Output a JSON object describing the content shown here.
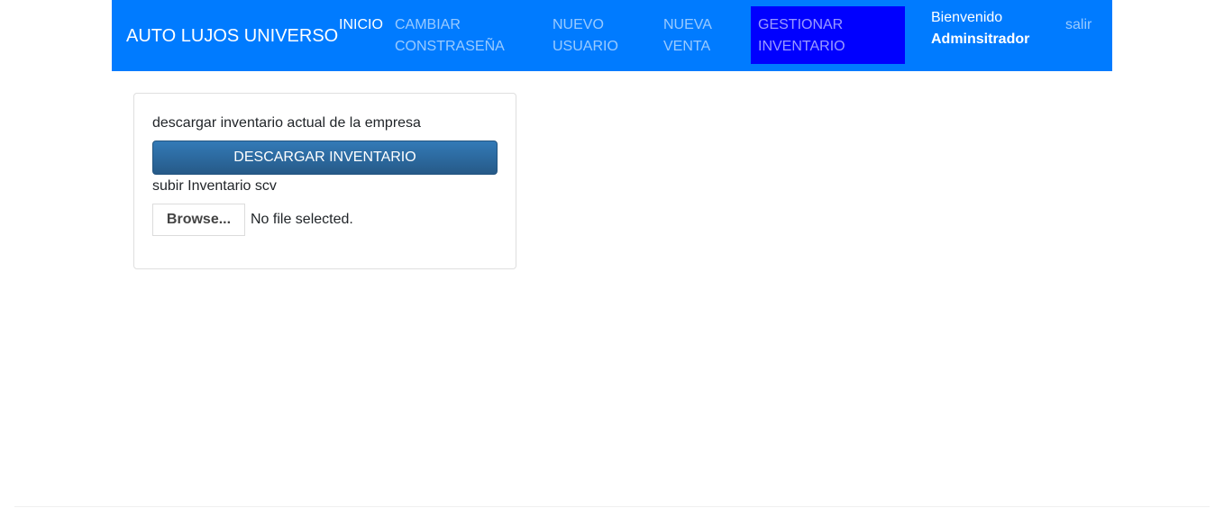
{
  "navbar": {
    "brand": "AUTO LUJOS UNIVERSO",
    "links": {
      "inicio": "INICIO",
      "cambiar": "CAMBIAR CONSTRASEÑA",
      "nuevo_usuario": "NUEVO USUARIO",
      "nueva_venta": "NUEVA VENTA",
      "gestionar": "GESTIONAR INVENTARIO"
    },
    "welcome": {
      "greeting": "Bienvenido",
      "user": "Adminsitrador"
    },
    "logout": "salir",
    "colors": {
      "background": "#007bff",
      "active_highlight": "#0000ff"
    }
  },
  "inventory_card": {
    "download_label": "descargar inventario actual de la empresa",
    "download_button": "DESCARGAR INVENTARIO",
    "upload_label": "subir Inventario scv",
    "browse_button": "Browse...",
    "file_status": "No file selected."
  }
}
